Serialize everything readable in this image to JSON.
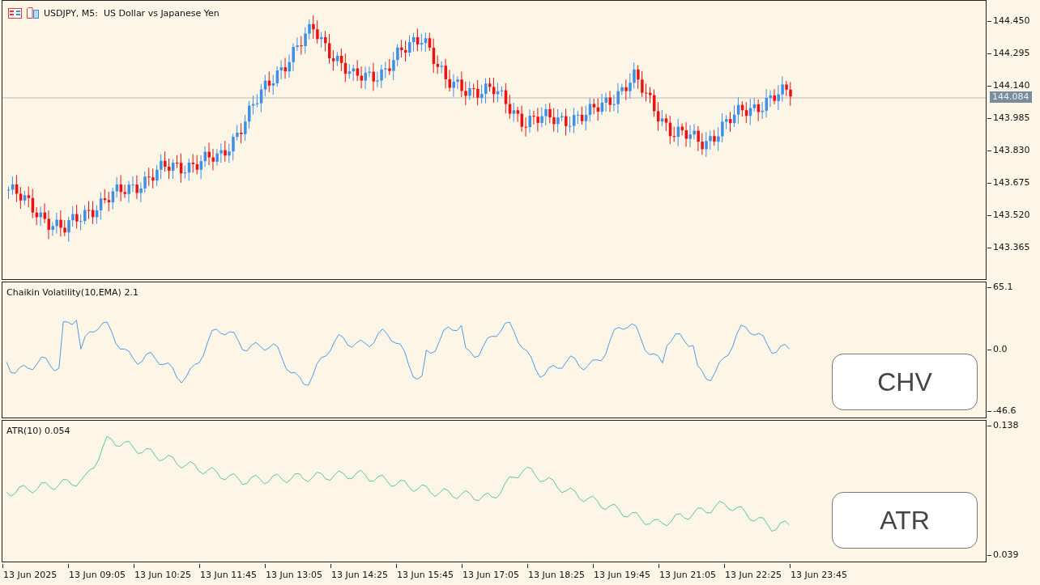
{
  "chart": {
    "title": "USDJPY, M5:  US Dollar vs Japanese Yen",
    "price_ticks": [
      "144.450",
      "144.295",
      "144.140",
      "143.985",
      "143.830",
      "143.675",
      "143.520",
      "143.365"
    ],
    "current_price": "144.084"
  },
  "indicators": [
    {
      "kind": "chv",
      "label": "Chaikin Volatility(10,EMA) 2.1",
      "ticks": [
        "65.1",
        "0.0",
        "-46.6"
      ],
      "badge": "CHV",
      "color": "#4f9be8"
    },
    {
      "kind": "atr",
      "label": "ATR(10) 0.054",
      "ticks": [
        "0.138",
        "0.039"
      ],
      "badge": "ATR",
      "color": "#5cc4a4"
    }
  ],
  "time_axis": [
    "13 Jun 2025",
    "13 Jun 09:05",
    "13 Jun 10:25",
    "13 Jun 11:45",
    "13 Jun 13:05",
    "13 Jun 14:25",
    "13 Jun 15:45",
    "13 Jun 17:05",
    "13 Jun 18:25",
    "13 Jun 19:45",
    "13 Jun 21:05",
    "13 Jun 22:25",
    "13 Jun 23:45"
  ]
}
